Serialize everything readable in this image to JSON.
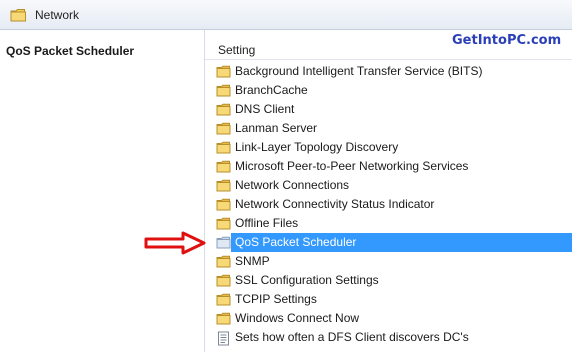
{
  "breadcrumb": {
    "label": "Network"
  },
  "left_pane": {
    "title": "QoS Packet Scheduler"
  },
  "right_pane": {
    "column_header": "Setting",
    "watermark": "GetIntoPC.com",
    "items": [
      {
        "label": "Background Intelligent Transfer Service (BITS)",
        "icon": "folder-icon"
      },
      {
        "label": "BranchCache",
        "icon": "folder-icon"
      },
      {
        "label": "DNS Client",
        "icon": "folder-icon"
      },
      {
        "label": "Lanman Server",
        "icon": "folder-icon"
      },
      {
        "label": "Link-Layer Topology Discovery",
        "icon": "folder-icon"
      },
      {
        "label": "Microsoft Peer-to-Peer Networking Services",
        "icon": "folder-icon"
      },
      {
        "label": "Network Connections",
        "icon": "folder-icon"
      },
      {
        "label": "Network Connectivity Status Indicator",
        "icon": "folder-icon"
      },
      {
        "label": "Offline Files",
        "icon": "folder-icon"
      },
      {
        "label": "QoS Packet Scheduler",
        "icon": "folder-icon",
        "selected": true
      },
      {
        "label": "SNMP",
        "icon": "folder-icon"
      },
      {
        "label": "SSL Configuration Settings",
        "icon": "folder-icon"
      },
      {
        "label": "TCPIP Settings",
        "icon": "folder-icon"
      },
      {
        "label": "Windows Connect Now",
        "icon": "folder-icon"
      },
      {
        "label": "Sets how often a DFS Client discovers DC's",
        "icon": "policy-setting-icon"
      }
    ]
  },
  "colors": {
    "selection": "#3399ff",
    "watermark": "#2b3fb8",
    "arrow": "#e01010",
    "folder": "#f2cc5a"
  }
}
